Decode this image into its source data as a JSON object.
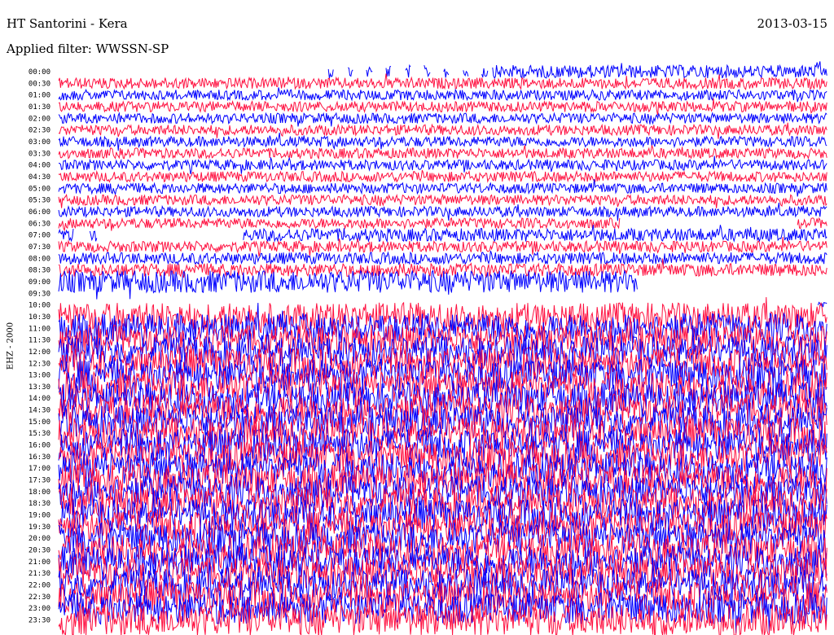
{
  "header": {
    "station": "HT Santorini - Kera",
    "date": "2013-03-15",
    "filter": "Applied filter: WWSSN-SP"
  },
  "channel_label": "EHZ - 2000",
  "colors": {
    "line_a": "#ff1040",
    "line_b": "#0000ff",
    "background": "#ffffff"
  },
  "chart_data": {
    "type": "line",
    "title": "HT Santorini - Kera",
    "subtitle": "Applied filter: WWSSN-SP",
    "ylabel": "EHZ - 2000",
    "xlabel": "",
    "y_tick_labels": [
      "00:00",
      "00:30",
      "01:00",
      "01:30",
      "02:00",
      "02:30",
      "03:00",
      "03:30",
      "04:00",
      "04:30",
      "05:00",
      "05:30",
      "06:00",
      "06:30",
      "07:00",
      "07:30",
      "08:00",
      "08:30",
      "09:00",
      "09:30",
      "10:00",
      "10:30",
      "11:00",
      "11:30",
      "12:00",
      "12:30",
      "13:00",
      "13:30",
      "14:00",
      "14:30",
      "15:00",
      "15:30",
      "16:00",
      "16:30",
      "17:00",
      "17:30",
      "18:00",
      "18:30",
      "19:00",
      "19:30",
      "20:00",
      "20:30",
      "21:00",
      "21:30",
      "22:00",
      "22:30",
      "23:00",
      "23:30"
    ],
    "row_minutes": 30,
    "grid": false,
    "series_colors_alternate": [
      "#0000ff",
      "#ff1040"
    ],
    "relative_amplitude": [
      0.35,
      0.3,
      0.28,
      0.28,
      0.28,
      0.28,
      0.28,
      0.28,
      0.28,
      0.28,
      0.28,
      0.28,
      0.28,
      0.28,
      0.35,
      0.3,
      0.32,
      0.35,
      0.6,
      0.3,
      0.2,
      0.75,
      0.8,
      0.8,
      0.82,
      0.82,
      0.85,
      0.85,
      0.85,
      0.85,
      0.85,
      0.85,
      0.85,
      0.85,
      0.85,
      0.85,
      0.85,
      0.85,
      0.85,
      0.85,
      0.85,
      0.85,
      0.85,
      0.85,
      0.85,
      0.85,
      0.85,
      0.85
    ],
    "data_gaps": [
      {
        "row": "00:00",
        "from_min": 0.0,
        "to_min": 10.3,
        "note": "no data"
      },
      {
        "row": "00:00",
        "from_min": 10.3,
        "to_min": 16.9,
        "note": "intermittent"
      },
      {
        "row": "06:30",
        "from_min": 21.9,
        "to_min": 28.8
      },
      {
        "row": "07:00",
        "from_min": 0.6,
        "to_min": 1.2
      },
      {
        "row": "07:00",
        "from_min": 1.5,
        "to_min": 7.2
      },
      {
        "row": "09:00",
        "from_min": 22.6,
        "to_min": 30.0
      },
      {
        "row": "09:30",
        "from_min": 0.0,
        "to_min": 30.0
      },
      {
        "row": "10:00",
        "from_min": 0.0,
        "to_min": 29.6
      }
    ]
  }
}
